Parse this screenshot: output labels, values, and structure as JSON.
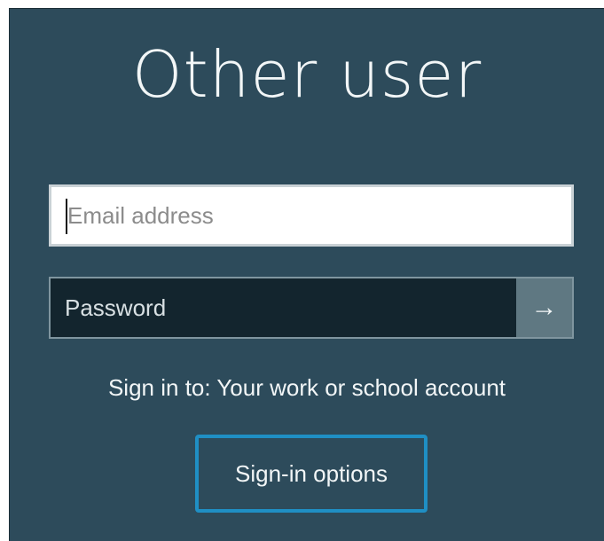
{
  "header": {
    "title": "Other user"
  },
  "form": {
    "email_placeholder": "Email address",
    "email_value": "",
    "password_placeholder": "Password",
    "password_value": "",
    "submit_icon": "→"
  },
  "footer": {
    "sign_in_to": "Sign in to: Your work or school account",
    "options_label": "Sign-in options"
  },
  "colors": {
    "background": "#2d4b5b",
    "password_field": "#13252e",
    "submit_button": "#5f7882",
    "focus_accent": "#1f8fc4"
  }
}
